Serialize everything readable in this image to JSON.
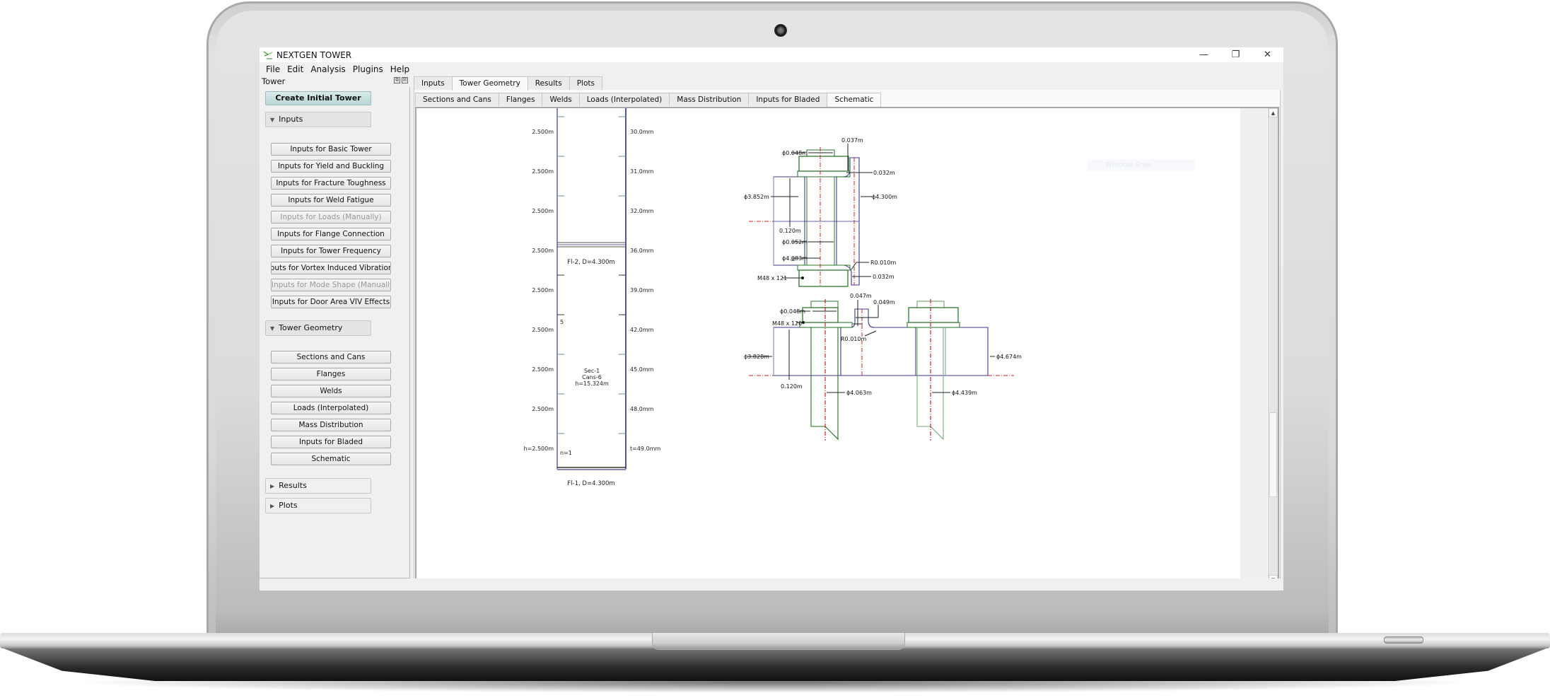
{
  "window": {
    "title": "NEXTGEN TOWER",
    "controls": {
      "minimize": "—",
      "restore": "❐",
      "close": "✕"
    }
  },
  "menu": [
    "File",
    "Edit",
    "Analysis",
    "Plugins",
    "Help"
  ],
  "dock": {
    "title": "Tower",
    "float_icon": "⧉",
    "close_icon": "☒",
    "create_button": "Create Initial Tower",
    "groups": [
      {
        "label": "Inputs",
        "expanded": true,
        "items": [
          {
            "label": "Inputs for Basic Tower",
            "enabled": true
          },
          {
            "label": "Inputs for Yield and Buckling",
            "enabled": true
          },
          {
            "label": "Inputs for Fracture Toughness",
            "enabled": true
          },
          {
            "label": "Inputs for Weld Fatigue",
            "enabled": true
          },
          {
            "label": "Inputs for Loads (Manually)",
            "enabled": false
          },
          {
            "label": "Inputs for Flange Connection",
            "enabled": true
          },
          {
            "label": "Inputs for Tower Frequency",
            "enabled": true
          },
          {
            "label": "Inputs for Vortex Induced Vibration Effects",
            "enabled": true
          },
          {
            "label": "Inputs for Mode Shape (Manually)",
            "enabled": false
          },
          {
            "label": "Inputs for Door Area VIV Effects",
            "enabled": true
          }
        ]
      },
      {
        "label": "Tower Geometry",
        "expanded": true,
        "items": [
          {
            "label": "Sections and Cans",
            "enabled": true
          },
          {
            "label": "Flanges",
            "enabled": true
          },
          {
            "label": "Welds",
            "enabled": true
          },
          {
            "label": "Loads (Interpolated)",
            "enabled": true
          },
          {
            "label": "Mass Distribution",
            "enabled": true
          },
          {
            "label": "Inputs for Bladed",
            "enabled": true
          },
          {
            "label": "Schematic",
            "enabled": true
          }
        ]
      },
      {
        "label": "Results",
        "expanded": false,
        "items": []
      },
      {
        "label": "Plots",
        "expanded": false,
        "items": []
      }
    ]
  },
  "tabs": {
    "main": [
      "Inputs",
      "Tower Geometry",
      "Results",
      "Plots"
    ],
    "main_active": "Tower Geometry",
    "sub": [
      "Sections and Cans",
      "Flanges",
      "Welds",
      "Loads (Interpolated)",
      "Mass Distribution",
      "Inputs for Bladed",
      "Schematic"
    ],
    "sub_active": "Schematic"
  },
  "overlay": {
    "snip_label": "Window Snip"
  },
  "colors": {
    "shell": "#2f2f8f",
    "bolt": "#1f6b1f",
    "centerline": "#cc1111",
    "dimension": "#222222",
    "create_button": "#c4dfdd"
  },
  "schematic": {
    "section": {
      "top_flange": "Fl-2, D=4.300m",
      "bottom_flange": "Fl-1, D=4.300m",
      "section_label": [
        "Sec-1",
        "Cans-6",
        "h=15.324m"
      ],
      "can_heights": [
        "2.500m",
        "2.500m",
        "2.500m",
        "2.500m",
        "2.500m",
        "2.500m",
        "2.500m",
        "2.500m",
        "h=2.500m"
      ],
      "can_thicknesses": [
        "30.0mm",
        "31.0mm",
        "32.0mm",
        "36.0mm",
        "39.0mm",
        "42.0mm",
        "45.0mm",
        "48.0mm",
        "t=49.0mm"
      ],
      "can_index_marker": "5",
      "bottom_index": "n=1"
    },
    "upper_flange": {
      "bolt_hole_dia": "ϕ0.048m",
      "neck_height": "0.037m",
      "neck_thickness_top": "0.032m",
      "inner_dia": "ϕ3.852m",
      "outer_dia": "ϕ4.300m",
      "flange_thickness": "0.120m",
      "washer_dia": "ϕ0.052m",
      "bolt_circle_dia": "ϕ4.083m",
      "fillet_radius": "R0.010m",
      "neck_thickness_bottom": "0.032m",
      "bolt_spec": "M48 x 121"
    },
    "lower_flange": {
      "bolt_hole_dia": "ϕ0.048m",
      "bolt_spec": "M48 x 120",
      "neck_height": "0.047m",
      "neck_thickness": "0.049m",
      "fillet_radius": "R0.010m",
      "inner_dia": "ϕ3.828m",
      "outer_dia": "ϕ4.674m",
      "flange_thickness": "0.120m",
      "inner_bolt_circle": "ϕ4.063m",
      "outer_bolt_circle": "ϕ4.439m"
    }
  }
}
